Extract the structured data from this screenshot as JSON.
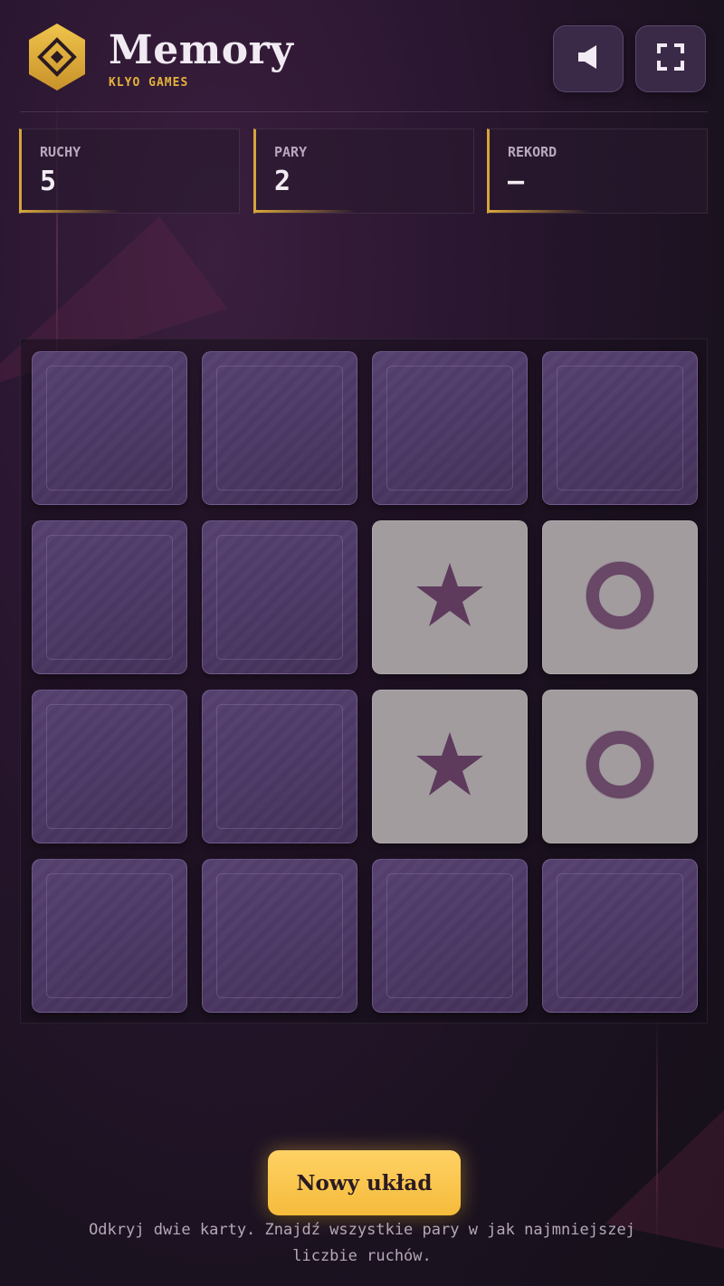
{
  "app": {
    "title": "Memory",
    "subtitle": "KLYO GAMES",
    "accent": "#e6b23a"
  },
  "header": {
    "sound_icon": "speaker-icon",
    "fullscreen_icon": "fullscreen-icon"
  },
  "stats": [
    {
      "label": "RUCHY",
      "value": "5"
    },
    {
      "label": "PARY",
      "value": "2"
    },
    {
      "label": "REKORD",
      "value": "—"
    }
  ],
  "board": {
    "rows": 4,
    "cols": 4,
    "cards": [
      {
        "state": "down",
        "symbol": ""
      },
      {
        "state": "down",
        "symbol": ""
      },
      {
        "state": "down",
        "symbol": ""
      },
      {
        "state": "down",
        "symbol": ""
      },
      {
        "state": "down",
        "symbol": ""
      },
      {
        "state": "down",
        "symbol": ""
      },
      {
        "state": "up",
        "symbol": "star-icon"
      },
      {
        "state": "up",
        "symbol": "ring-icon"
      },
      {
        "state": "down",
        "symbol": ""
      },
      {
        "state": "down",
        "symbol": ""
      },
      {
        "state": "up",
        "symbol": "star-icon"
      },
      {
        "state": "up",
        "symbol": "ring-icon"
      },
      {
        "state": "down",
        "symbol": ""
      },
      {
        "state": "down",
        "symbol": ""
      },
      {
        "state": "down",
        "symbol": ""
      },
      {
        "state": "down",
        "symbol": ""
      }
    ],
    "symbol_color": "#5e3a5c"
  },
  "footer": {
    "new_game_label": "Nowy układ",
    "hint_line1": "Odkryj dwie karty. Znajdź wszystkie pary w jak najmniejszej",
    "hint_line2": "liczbie ruchów."
  }
}
